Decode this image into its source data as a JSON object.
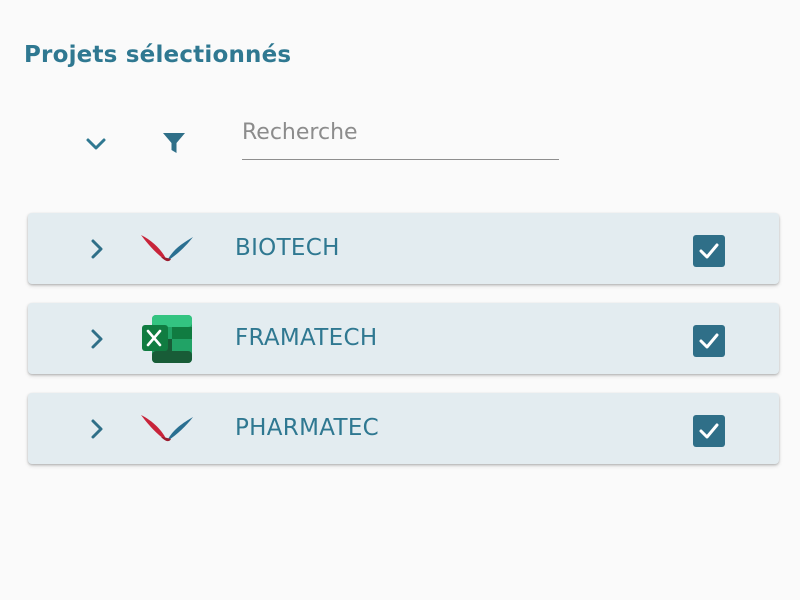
{
  "header": {
    "title": "Projets sélectionnés"
  },
  "toolbar": {
    "expand_icon": "chevron-down-icon",
    "filter_icon": "filter-icon",
    "search_placeholder": "Recherche"
  },
  "projects": [
    {
      "name": "BIOTECH",
      "icon": "wing-logo",
      "checked": true
    },
    {
      "name": "FRAMATECH",
      "icon": "excel-icon",
      "checked": true
    },
    {
      "name": "PHARMATEC",
      "icon": "wing-logo",
      "checked": true
    }
  ],
  "colors": {
    "accent": "#2f7891",
    "row_background": "#e3ecf0",
    "checkbox": "#2f6f88",
    "logo_red": "#c8243a",
    "logo_blue": "#2a6f91",
    "excel_green": "#1e7145"
  }
}
